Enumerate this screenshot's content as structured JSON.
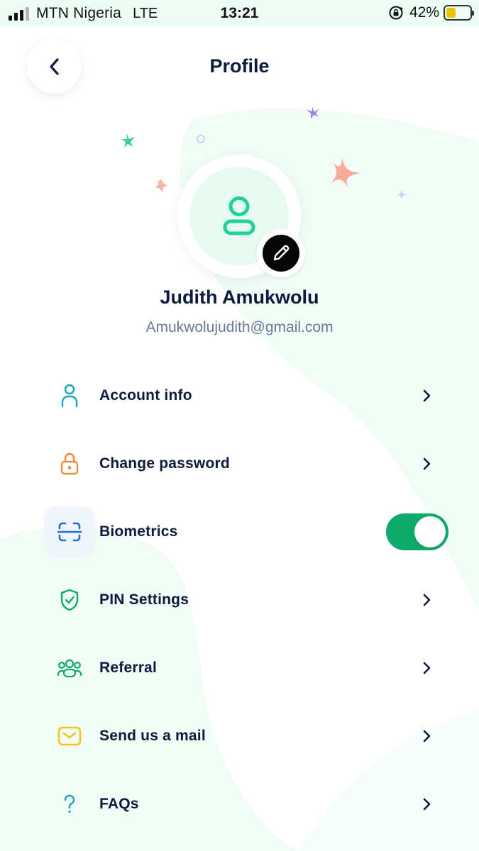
{
  "status_bar": {
    "carrier": "MTN Nigeria",
    "network": "LTE",
    "time": "13:21",
    "battery_percent": "42%",
    "battery_level": 0.42
  },
  "header": {
    "title": "Profile",
    "back_icon": "chevron-left-icon"
  },
  "profile": {
    "name": "Judith Amukwolu",
    "email": "Amukwolujudith@gmail.com",
    "avatar_icon": "user-icon",
    "edit_icon": "pencil-icon"
  },
  "menu": {
    "items": [
      {
        "label": "Account info",
        "icon": "user-icon",
        "action": "chevron"
      },
      {
        "label": "Change password",
        "icon": "lock-icon",
        "action": "chevron"
      },
      {
        "label": "Biometrics",
        "icon": "face-scan-icon",
        "action": "toggle",
        "enabled": true
      },
      {
        "label": "PIN Settings",
        "icon": "shield-check-icon",
        "action": "chevron"
      },
      {
        "label": "Referral",
        "icon": "users-icon",
        "action": "chevron"
      },
      {
        "label": "Send us a mail",
        "icon": "mail-icon",
        "action": "chevron"
      },
      {
        "label": "FAQs",
        "icon": "question-icon",
        "action": "chevron"
      }
    ]
  },
  "colors": {
    "accent_green": "#0caa6a",
    "mint": "#20d19a",
    "title_navy": "#0f1b3d",
    "email_gray": "#6b7896",
    "orange": "#f08a3c",
    "yellow": "#f5c518",
    "teal": "#1aa6b7"
  }
}
